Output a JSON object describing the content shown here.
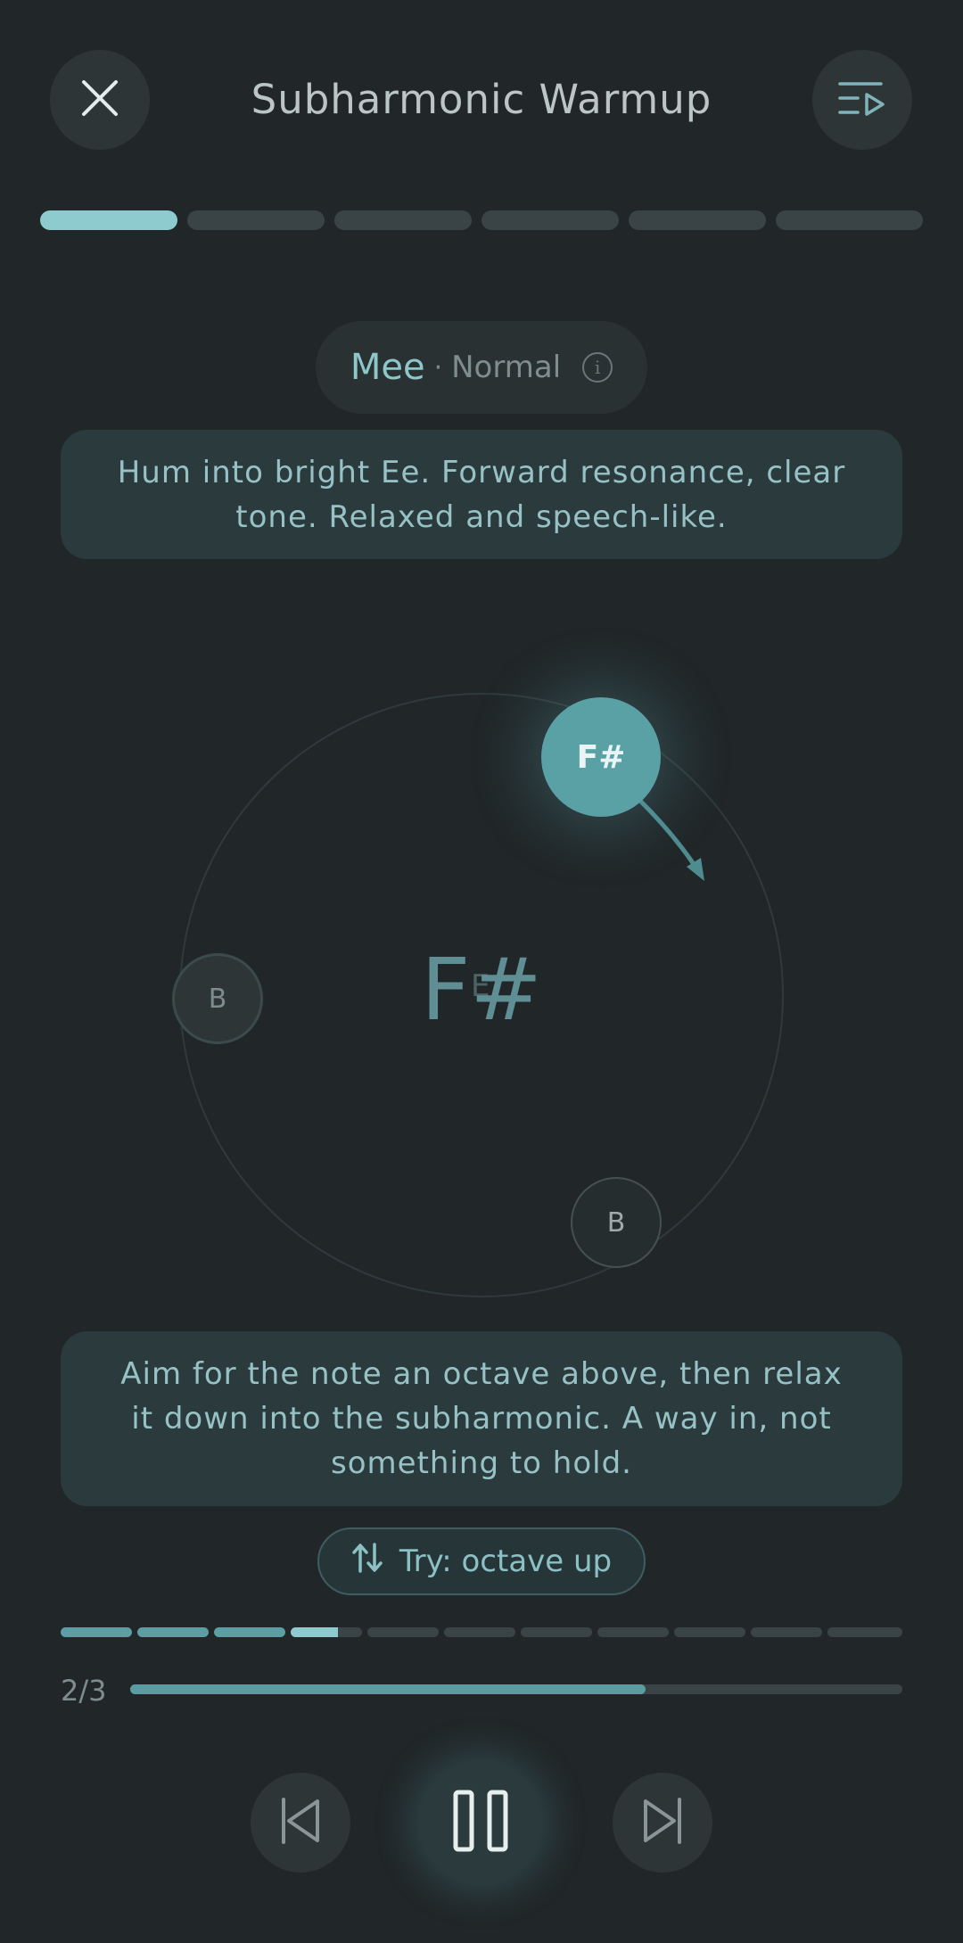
{
  "header": {
    "title": "Subharmonic Warmup",
    "close_icon": "close-icon",
    "playlist_icon": "playlist-play-icon"
  },
  "exercise_steps": {
    "total": 6,
    "current": 1
  },
  "mode": {
    "vowel": "Mee",
    "separator": "·",
    "name": "Normal",
    "info_glyph": "i"
  },
  "instruction_top": "Hum into bright Ee. Forward resonance, clear tone. Relaxed and speech-like.",
  "pitch_orbit": {
    "center_note": "F#",
    "center_ghost": "E",
    "active_target": "F#",
    "left_target": "B",
    "bottom_target": "B"
  },
  "instruction_bottom": "Aim for the note an octave above, then relax it down into the subharmonic. A way in, not something to hold.",
  "try_button": {
    "label": "Try: octave up",
    "icon": "swap-vertical-icon"
  },
  "rep_progress": {
    "total_ticks": 11,
    "completed": 3,
    "current": 4
  },
  "set_progress": {
    "label": "2/3",
    "fraction": 0.667
  },
  "transport": {
    "prev_icon": "skip-previous-icon",
    "pause_icon": "pause-icon",
    "next_icon": "skip-next-icon"
  },
  "colors": {
    "background": "#212729",
    "accent": "#5aa1a6",
    "accent_light": "#8ecbcf",
    "card": "#2b3a3d"
  }
}
